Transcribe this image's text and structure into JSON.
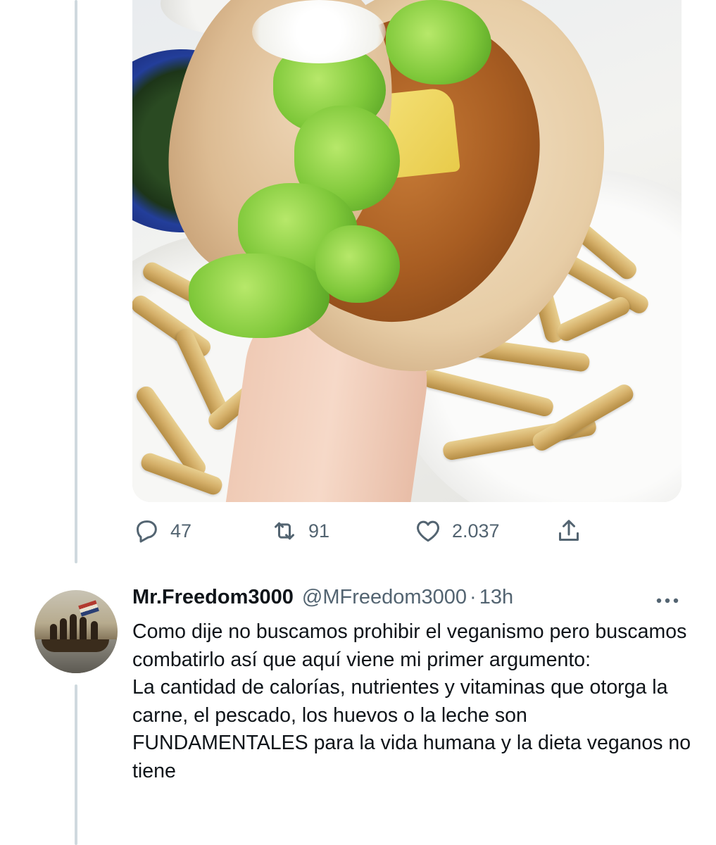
{
  "media": {
    "description_icon": "photo"
  },
  "actions": {
    "reply": {
      "icon": "reply-icon",
      "count": "47"
    },
    "retweet": {
      "icon": "retweet-icon",
      "count": "91"
    },
    "like": {
      "icon": "heart-icon",
      "count": "2.037"
    },
    "share": {
      "icon": "share-icon"
    }
  },
  "reply_tweet": {
    "display_name": "Mr.Freedom3000",
    "handle": "@MFreedom3000",
    "separator": "·",
    "time": "13h",
    "text": "Como dije no buscamos prohibir el veganismo pero buscamos combatirlo así que aquí viene mi primer argumento:\nLa cantidad de calorías, nutrientes y vitaminas que otorga la carne, el pescado, los huevos o la leche son FUNDAMENTALES para la vida humana y la dieta veganos no tiene"
  },
  "colors": {
    "text_primary": "#0f1419",
    "text_secondary": "#536471",
    "thread_line": "#cfd9de",
    "background": "#ffffff"
  }
}
